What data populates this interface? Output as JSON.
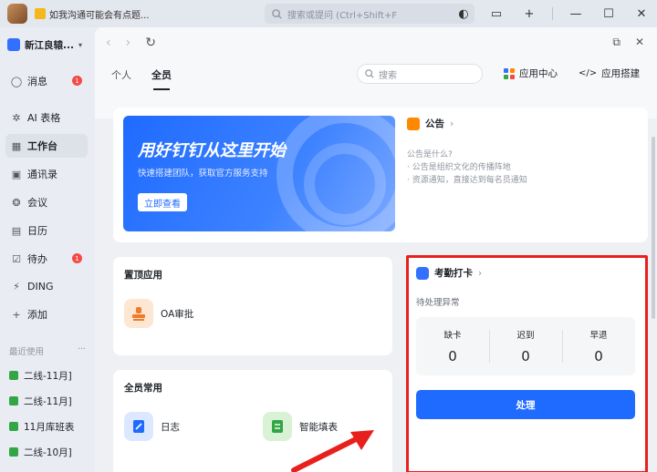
{
  "titlebar": {
    "app_tab_label": "如我沟通可能会有点题...",
    "search_placeholder": "搜索或提问 (Ctrl+Shift+F"
  },
  "sidebar": {
    "org_name": "新江良辕...",
    "items": [
      {
        "label": "消息",
        "icon": "chat-icon",
        "badge": "1"
      },
      {
        "label": "AI 表格",
        "icon": "ai-table-icon"
      },
      {
        "label": "工作台",
        "icon": "grid-icon",
        "active": true
      },
      {
        "label": "通讯录",
        "icon": "contacts-icon"
      },
      {
        "label": "会议",
        "icon": "meeting-icon"
      },
      {
        "label": "日历",
        "icon": "calendar-icon"
      },
      {
        "label": "待办",
        "icon": "todo-icon",
        "badge": "1"
      },
      {
        "label": "DING",
        "icon": "ding-icon"
      },
      {
        "label": "添加",
        "icon": "plus-icon"
      }
    ],
    "recent_title": "最近使用",
    "recent_more": "···",
    "recent_items": [
      "二线-11月]",
      "二线-11月]",
      "11月库班表",
      "二线-10月]"
    ]
  },
  "main": {
    "tabs": [
      "个人",
      "全员"
    ],
    "search_placeholder": "搜索",
    "app_center": "应用中心",
    "app_builder": "应用搭建",
    "banner": {
      "title": "用好钉钉从这里开始",
      "subtitle": "快速搭建团队，获取官方服务支持",
      "button": "立即查看"
    },
    "notice": {
      "title": "公告",
      "lines": [
        "公告是什么?",
        "· 公告是组织文化的传播阵地",
        "· 资源通知，直接达到每名员通知"
      ]
    },
    "pinned": {
      "title": "置顶应用",
      "app": "OA审批"
    },
    "common": {
      "title": "全员常用",
      "apps": [
        "日志",
        "智能填表"
      ]
    },
    "attendance": {
      "title": "考勤打卡",
      "status": "待处理异常",
      "stats": [
        {
          "label": "缺卡",
          "value": "0"
        },
        {
          "label": "迟到",
          "value": "0"
        },
        {
          "label": "早退",
          "value": "0"
        }
      ],
      "button": "处理"
    }
  },
  "colors": {
    "accent": "#1f6bff",
    "highlight": "#e8201d",
    "badge": "#f54a45"
  }
}
